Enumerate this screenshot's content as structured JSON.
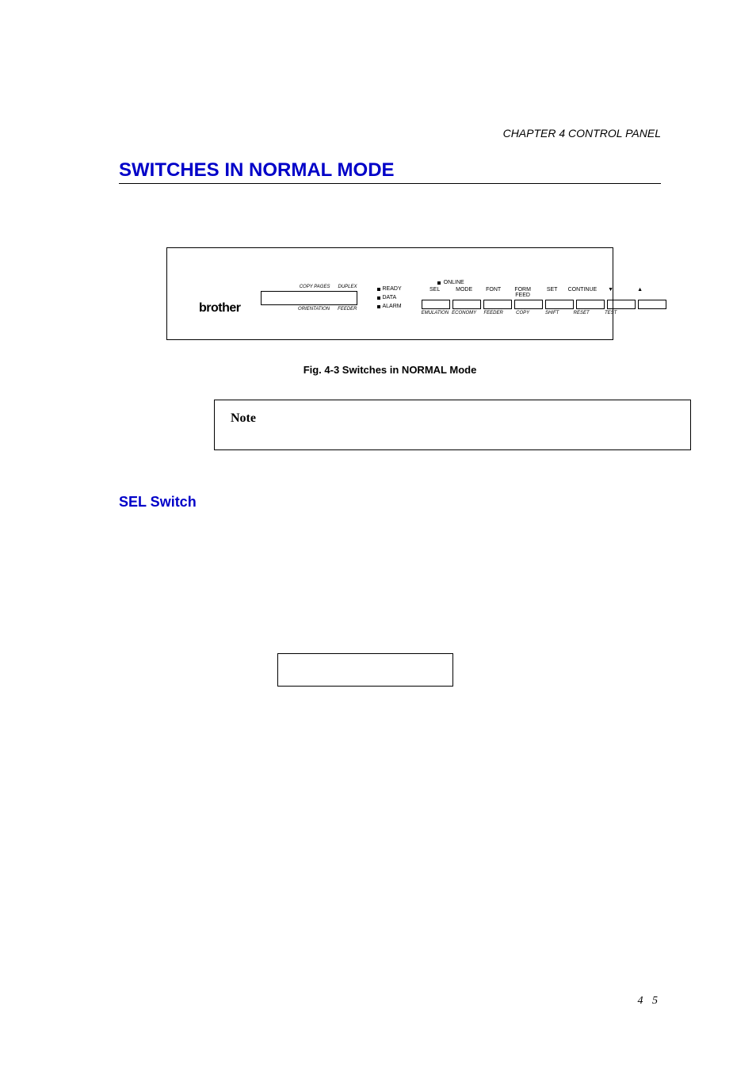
{
  "chapter_header": "CHAPTER 4 CONTROL PANEL",
  "section_title": "SWITCHES IN NORMAL MODE",
  "panel": {
    "brand": "brother",
    "lcd_top_labels": [
      "COPY PAGES",
      "DUPLEX"
    ],
    "lcd_bottom_labels": [
      "ORIENTATION",
      "FEEDER"
    ],
    "leds": {
      "online": "ONLINE",
      "ready": "READY",
      "data": "DATA",
      "alarm": "ALARM"
    },
    "top_labels": [
      "SEL",
      "MODE",
      "FONT",
      "FORM FEED",
      "SET",
      "CONTINUE",
      "▼",
      "▲"
    ],
    "bottom_labels": [
      "EMULATION",
      "ECONOMY",
      "FEEDER",
      "COPY",
      "SHIFT",
      "RESET",
      "TEST"
    ]
  },
  "figure_caption": "Fig. 4-3  Switches in NORMAL Mode",
  "note_label": "Note",
  "subheading": "SEL Switch",
  "page_number": "4 5"
}
